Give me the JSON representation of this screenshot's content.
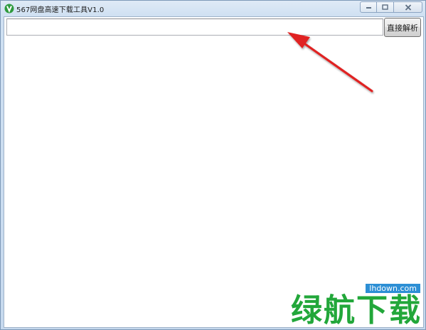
{
  "window": {
    "title": "567网盘高速下载工具V1.0"
  },
  "toolbar": {
    "url_value": "",
    "url_placeholder": "",
    "parse_label": "直接解析"
  },
  "watermark": {
    "url": "lhdown.com",
    "brand": "绿航下载"
  },
  "colors": {
    "arrow": "#e02020",
    "brand_green": "#22a73a",
    "url_badge": "#2d8fd5"
  },
  "icons": {
    "app": "app-logo-icon",
    "minimize": "minimize-icon",
    "maximize": "maximize-icon",
    "close": "close-icon"
  }
}
